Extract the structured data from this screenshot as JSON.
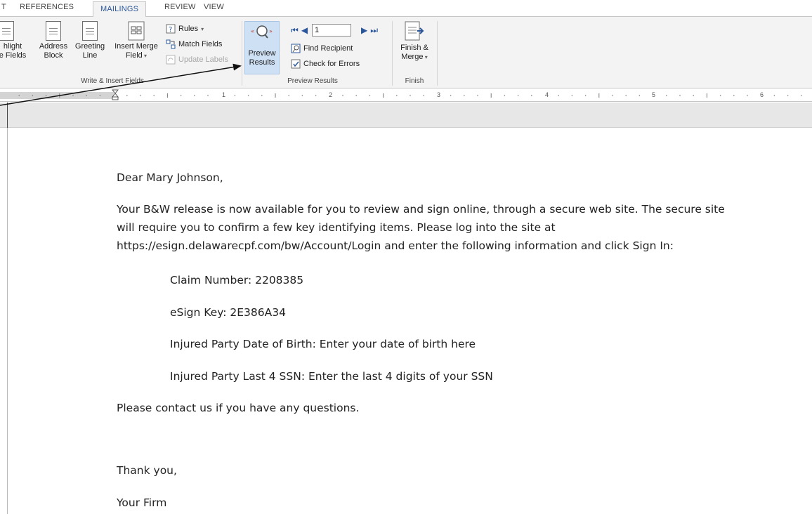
{
  "tabs": [
    {
      "label": "T"
    },
    {
      "label": "REFERENCES"
    },
    {
      "label": "MAILINGS"
    },
    {
      "label": "REVIEW"
    },
    {
      "label": "VIEW"
    }
  ],
  "ribbon": {
    "write_insert": {
      "group_label": "Write & Insert Fields",
      "highlight_line1": "hlight",
      "highlight_line2": "e Fields",
      "address_line1": "Address",
      "address_line2": "Block",
      "greeting_line1": "Greeting",
      "greeting_line2": "Line",
      "insert_line1": "Insert Merge",
      "insert_line2": "Field",
      "rules": "Rules",
      "match_fields": "Match Fields",
      "update_labels": "Update Labels"
    },
    "preview": {
      "group_label": "Preview Results",
      "button_line1": "Preview",
      "button_line2": "Results",
      "record_value": "1",
      "find_recipient": "Find Recipient",
      "check_errors": "Check for Errors"
    },
    "finish": {
      "group_label": "Finish",
      "button_line1": "Finish &",
      "button_line2": "Merge"
    }
  },
  "ruler": {
    "numbers": [
      "1",
      "2",
      "3",
      "4",
      "5",
      "6"
    ]
  },
  "document": {
    "greeting": "Dear Mary Johnson,",
    "body_line1": "Your B&W release is now available for you to review and sign online, through a secure web site. The secure site",
    "body_line2": "will require you to confirm a few key identifying items. Please log into the site at",
    "body_line3": "https://esign.delawarecpf.com/bw/Account/Login and enter the following information and click Sign In:",
    "claim": "Claim Number: 2208385",
    "esign": "eSign Key: 2E386A34",
    "dob": "Injured Party Date of Birth: Enter your date of birth here",
    "ssn": "Injured Party Last 4 SSN: Enter the last 4 digits of your SSN",
    "contact": "Please contact us if you have any questions.",
    "thanks": "Thank you,",
    "signature": "Your Firm"
  }
}
